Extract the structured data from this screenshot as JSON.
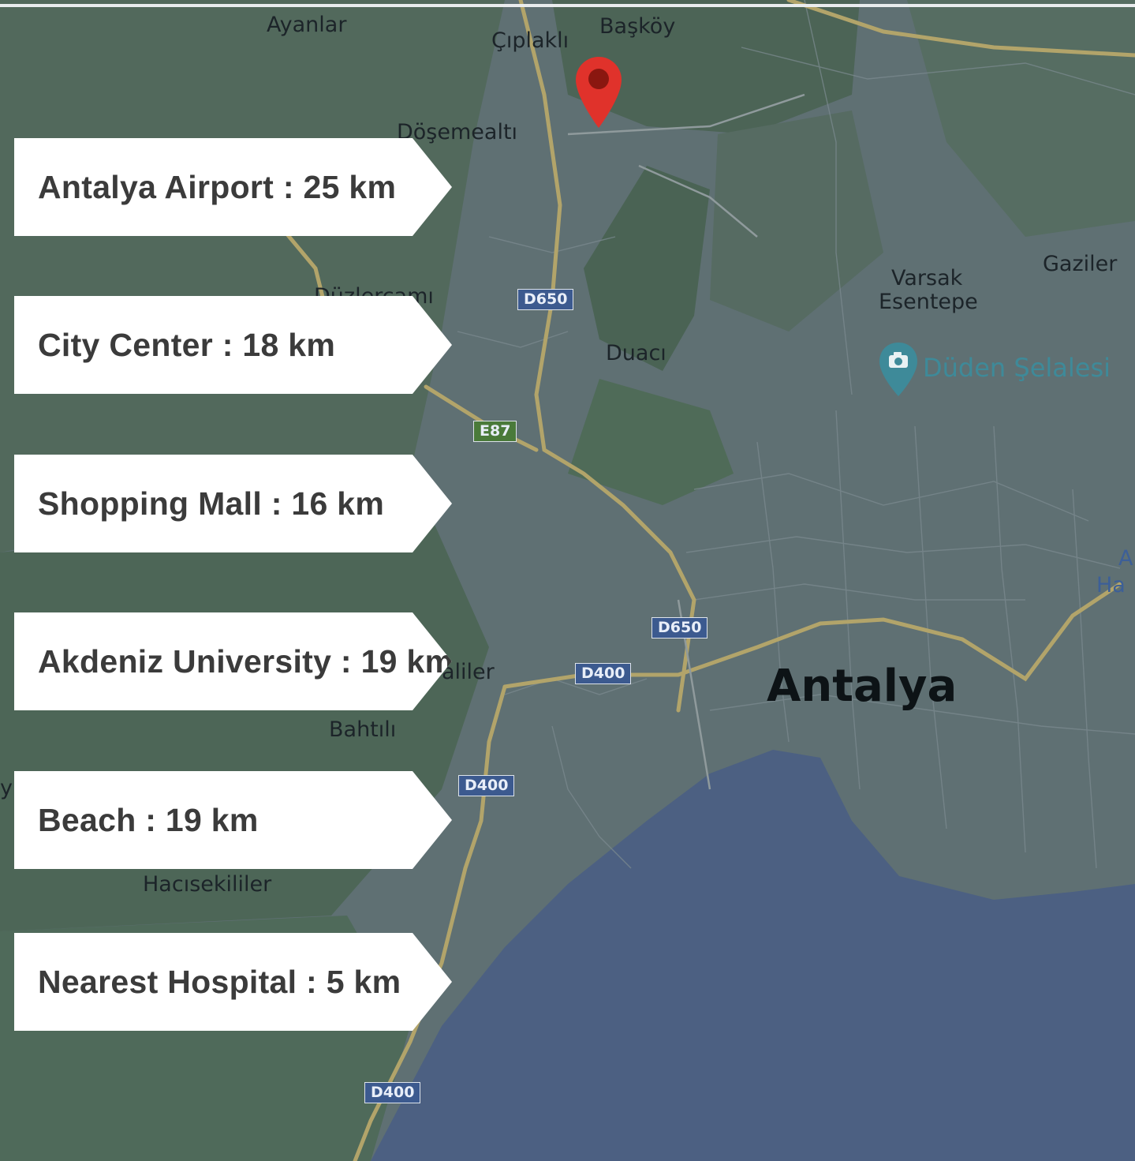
{
  "map": {
    "city_label": "Antalya",
    "places": [
      "Ayanlar",
      "Çıplaklı",
      "Başköy",
      "Döşemealtı",
      "Düzlerçamı",
      "Duacı",
      "Varsak",
      "Esentepe",
      "Gaziler",
      "Hacısekililer",
      "Bahtılı",
      "aliler",
      "A",
      "Ha",
      "y"
    ],
    "poi": {
      "label": "Düden Şelalesi",
      "icon": "camera-pin-icon"
    },
    "road_shields": [
      "D650",
      "E87",
      "D650",
      "D400",
      "D400",
      "D400"
    ],
    "marker": {
      "icon": "location-pin-icon",
      "color": "#e0322b"
    }
  },
  "distances": [
    {
      "label": "Antalya Airport : 25 km"
    },
    {
      "label": "City Center : 18 km"
    },
    {
      "label": "Shopping Mall : 16 km"
    },
    {
      "label": "Akdeniz University : 19 km"
    },
    {
      "label": "Beach : 19 km"
    },
    {
      "label": "Nearest Hospital : 5 km"
    }
  ],
  "colors": {
    "sea": "#4c6082",
    "land": "#5f7073",
    "forest": "#4f6b5a",
    "road": "#b2a46a",
    "tag_background": "#ffffff",
    "tag_text": "#3b3b3b"
  }
}
